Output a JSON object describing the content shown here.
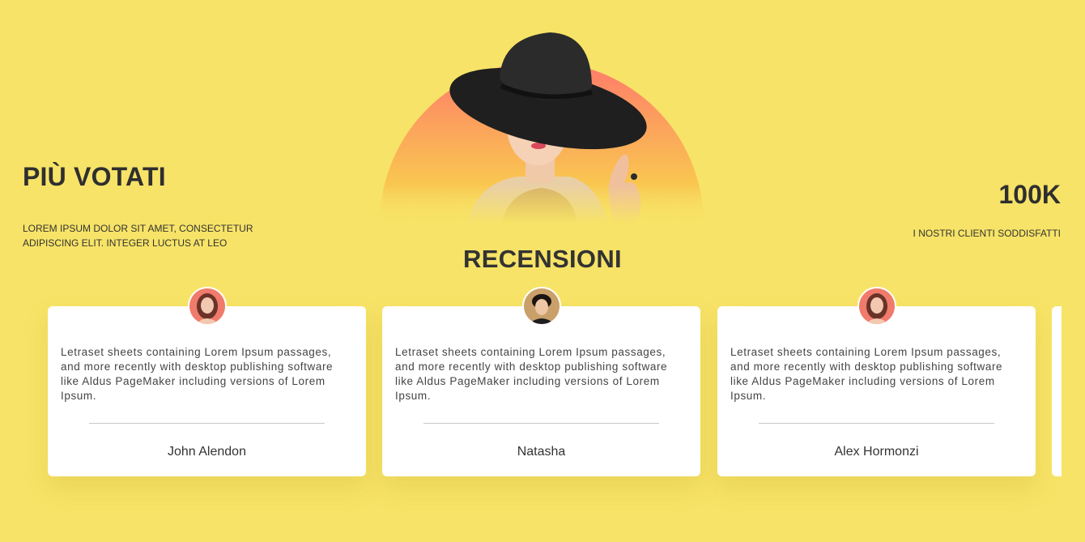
{
  "hero": {
    "title": "PIÙ VOTATI",
    "subtitle": "LOREM IPSUM DOLOR SIT AMET, CONSECTETUR ADIPISCING ELIT. INTEGER LUCTUS AT LEO",
    "stat_value": "100K",
    "stat_label": "I NOSTRI CLIENTI SODDISFATTI",
    "image_icon": "woman-in-black-hat-photo"
  },
  "reviews": {
    "title": "RECENSIONI",
    "items": [
      {
        "text": "Letraset sheets containing Lorem Ipsum passages, and more recently with desktop publishing software like Aldus PageMaker including versions of Lorem Ipsum.",
        "author": "John Alendon",
        "avatar": "woman-avatar"
      },
      {
        "text": "Letraset sheets containing Lorem Ipsum passages, and more recently with desktop publishing software like Aldus PageMaker including versions of Lorem Ipsum.",
        "author": "Natasha",
        "avatar": "man-avatar"
      },
      {
        "text": "Letraset sheets containing Lorem Ipsum passages, and more recently with desktop publishing software like Aldus PageMaker including versions of Lorem Ipsum.",
        "author": "Alex Hormonzi",
        "avatar": "woman-avatar"
      }
    ]
  },
  "colors": {
    "background": "#f7e367",
    "text": "#2f2f2f",
    "card": "#ffffff",
    "gradient_top": "#ff7a6b",
    "gradient_bottom": "#f9c650"
  }
}
